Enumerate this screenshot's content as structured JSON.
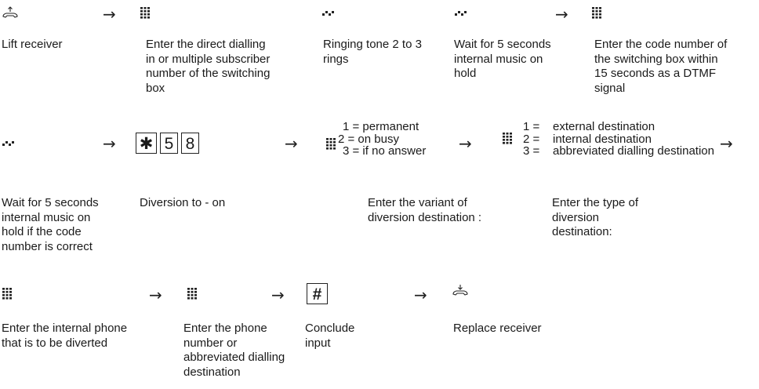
{
  "row1": {
    "steps": [
      "Lift receiver",
      [
        "Enter the direct dialling",
        "in or multiple subscriber",
        "number of the switching",
        "box"
      ],
      [
        "Ringing tone 2 to 3",
        "rings"
      ],
      [
        "Wait for 5 seconds",
        "internal music on",
        "hold"
      ],
      [
        "Enter the code number of",
        "the switching box within",
        "15 seconds as a DTMF",
        "signal"
      ]
    ]
  },
  "row2": {
    "keys": [
      "✱",
      "5",
      "8"
    ],
    "variant_options": [
      "1 = permanent",
      "2 = on busy",
      "3 = if no answer"
    ],
    "type_numbers": [
      "1 =",
      "2 =",
      "3 ="
    ],
    "type_labels": [
      "external destination",
      "internal destination",
      "abbreviated dialling destination"
    ],
    "steps": [
      [
        "Wait for 5 seconds",
        "internal music on",
        "hold if the code",
        "number is correct"
      ],
      "Diversion to - on",
      [
        "Enter the variant of",
        "diversion destination :"
      ],
      [
        "Enter the type of",
        "diversion",
        "destination:"
      ]
    ]
  },
  "row3": {
    "hash_key": "#",
    "steps": [
      [
        "Enter the internal phone",
        "that is to be diverted"
      ],
      [
        "Enter the phone",
        "number or",
        "abbreviated dialling",
        "destination"
      ],
      [
        "Conclude",
        "input"
      ],
      "Replace receiver"
    ]
  },
  "arrow_glyph": "→",
  "icons": [
    "lift-receiver-icon",
    "keypad-icon",
    "ringing-tone-icon",
    "wait-tone-icon",
    "replace-receiver-icon"
  ]
}
